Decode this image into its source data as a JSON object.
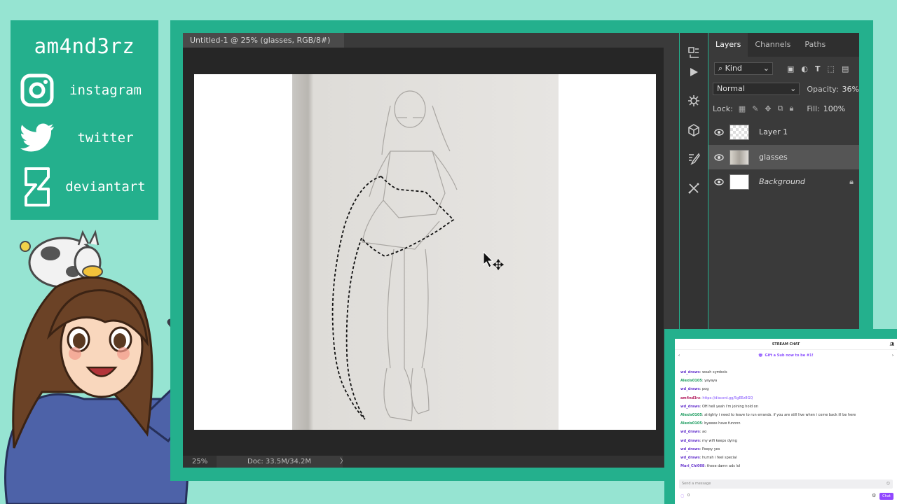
{
  "social": {
    "handle": "am4nd3rz",
    "links": [
      {
        "label": "instagram",
        "icon": "instagram-icon"
      },
      {
        "label": "twitter",
        "icon": "twitter-icon"
      },
      {
        "label": "deviantart",
        "icon": "deviantart-icon"
      }
    ]
  },
  "photoshop": {
    "doc_tab": "Untitled-1 @ 25% (glasses, RGB/8#) *",
    "close_glyph": "×",
    "status": {
      "zoom": "25%",
      "doc": "Doc: 33.5M/34.2M",
      "arrow": "〉"
    },
    "panel": {
      "tabs": [
        "Layers",
        "Channels",
        "Paths"
      ],
      "filter": "Kind",
      "blend_mode": "Normal",
      "opacity_label": "Opacity:",
      "opacity": "36%",
      "lock_label": "Lock:",
      "fill_label": "Fill:",
      "fill": "100%",
      "layers": [
        {
          "name": "Layer 1",
          "selected": false
        },
        {
          "name": "glasses",
          "selected": true
        },
        {
          "name": "Background",
          "selected": false,
          "locked": true
        }
      ]
    }
  },
  "chat": {
    "title": "STREAM CHAT",
    "gift": "Gift a Sub now to be #1!",
    "messages": [
      {
        "user": "wd_draws",
        "text": "woah symbols"
      },
      {
        "user": "Alexis0105",
        "text": "yayaya"
      },
      {
        "user": "wd_draws",
        "text": "pog"
      },
      {
        "user": "am4nd3rz",
        "text": "https://discord.gg/5gEEz8GQ"
      },
      {
        "user": "wd_draws",
        "text": "OH hell yeah i'm joining hold on"
      },
      {
        "user": "Alexis0105",
        "text": "alrighty i need to leave to run errands. if you are still live when i come back ill be here"
      },
      {
        "user": "Alexis0105",
        "text": "byeeee have funnnn"
      },
      {
        "user": "wd_draws",
        "text": "ao"
      },
      {
        "user": "wd_draws",
        "text": "my wifi keeps dying"
      },
      {
        "user": "wd_draws",
        "text": "Peepy yes"
      },
      {
        "user": "wd_draws",
        "text": "hurrah i feel special"
      },
      {
        "user": "Mari_Chi008",
        "text": "these damn ads lol"
      }
    ],
    "input_placeholder": "Send a message",
    "send_label": "Chat",
    "points": "0"
  }
}
